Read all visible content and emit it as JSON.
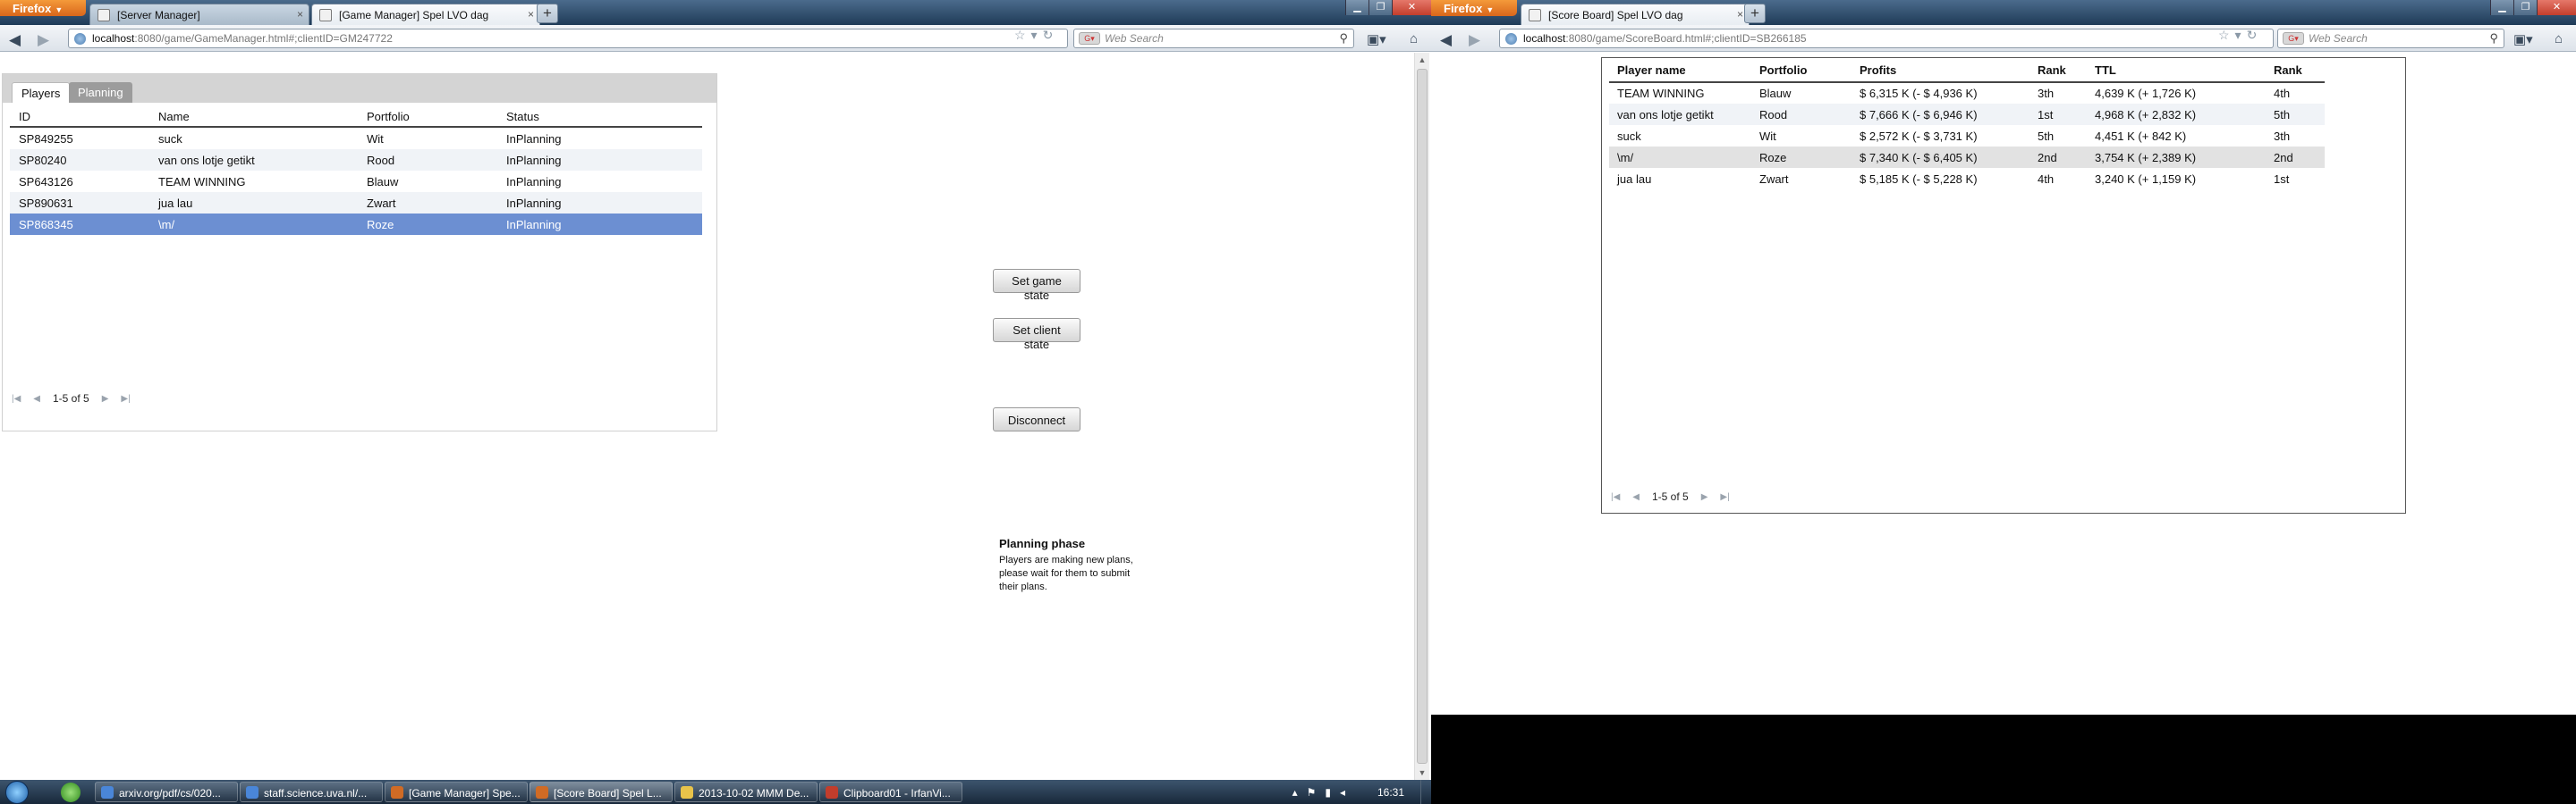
{
  "left": {
    "firefox_button": "Firefox",
    "tabs": [
      {
        "title": "[Server Manager]"
      },
      {
        "title": "[Game Manager] Spel LVO dag"
      }
    ],
    "url": {
      "host": "localhost",
      "rest": ":8080/game/GameManager.html#;clientID=GM247722"
    },
    "search_placeholder": "Web Search",
    "app_tabs": [
      "Players",
      "Planning"
    ],
    "columns": [
      "ID",
      "Name",
      "Portfolio",
      "Status"
    ],
    "rows": [
      {
        "id": "SP849255",
        "name": "suck",
        "portfolio": "Wit",
        "status": "InPlanning"
      },
      {
        "id": "SP80240",
        "name": "van ons lotje getikt",
        "portfolio": "Rood",
        "status": "InPlanning"
      },
      {
        "id": "SP643126",
        "name": "TEAM WINNING",
        "portfolio": "Blauw",
        "status": "InPlanning"
      },
      {
        "id": "SP890631",
        "name": "jua lau",
        "portfolio": "Zwart",
        "status": "InPlanning"
      },
      {
        "id": "SP868345",
        "name": "\\m/",
        "portfolio": "Roze",
        "status": "InPlanning"
      }
    ],
    "pager": "1-5 of 5",
    "buttons": {
      "set_game_state_l1": "Set game",
      "set_game_state_l2": "state",
      "set_client_state_l1": "Set client",
      "set_client_state_l2": "state",
      "disconnect": "Disconnect"
    },
    "phase": {
      "title": "Planning phase",
      "text": "Players are making new plans, please wait for them to submit their plans."
    }
  },
  "right": {
    "firefox_button": "Firefox",
    "tabs": [
      {
        "title": "[Score Board] Spel LVO dag"
      }
    ],
    "url": {
      "host": "localhost",
      "rest": ":8080/game/ScoreBoard.html#;clientID=SB266185"
    },
    "search_placeholder": "Web Search",
    "columns": [
      "Player name",
      "Portfolio",
      "Profits",
      "Rank",
      "TTL",
      "Rank"
    ],
    "rows": [
      {
        "player": "TEAM WINNING",
        "portfolio": "Blauw",
        "profits": "$ 6,315 K (- $ 4,936 K)",
        "rank": "3th",
        "ttl": "4,639 K (+ 1,726 K)",
        "rank2": "4th"
      },
      {
        "player": "van ons lotje getikt",
        "portfolio": "Rood",
        "profits": "$ 7,666 K (- $ 6,946 K)",
        "rank": "1st",
        "ttl": "4,968 K (+ 2,832 K)",
        "rank2": "5th"
      },
      {
        "player": "suck",
        "portfolio": "Wit",
        "profits": "$ 2,572 K (- $ 3,731 K)",
        "rank": "5th",
        "ttl": "4,451 K (+ 842 K)",
        "rank2": "3th"
      },
      {
        "player": "\\m/",
        "portfolio": "Roze",
        "profits": "$ 7,340 K (- $ 6,405 K)",
        "rank": "2nd",
        "ttl": "3,754 K (+ 2,389 K)",
        "rank2": "2nd"
      },
      {
        "player": "jua lau",
        "portfolio": "Zwart",
        "profits": "$ 5,185 K (- $ 5,228 K)",
        "rank": "4th",
        "ttl": "3,240 K (+ 1,159 K)",
        "rank2": "1st"
      }
    ],
    "pager": "1-5 of 5"
  },
  "taskbar": {
    "items": [
      "arxiv.org/pdf/cs/020...",
      "staff.science.uva.nl/...",
      "[Game Manager] Spe...",
      "[Score Board] Spel L...",
      "2013-10-02 MMM De...",
      "Clipboard01 - IrfanVi..."
    ],
    "clock": "16:31"
  },
  "colors": {
    "selected_row": "#6c8fd2",
    "firefox_orange": "#e07a2a"
  }
}
